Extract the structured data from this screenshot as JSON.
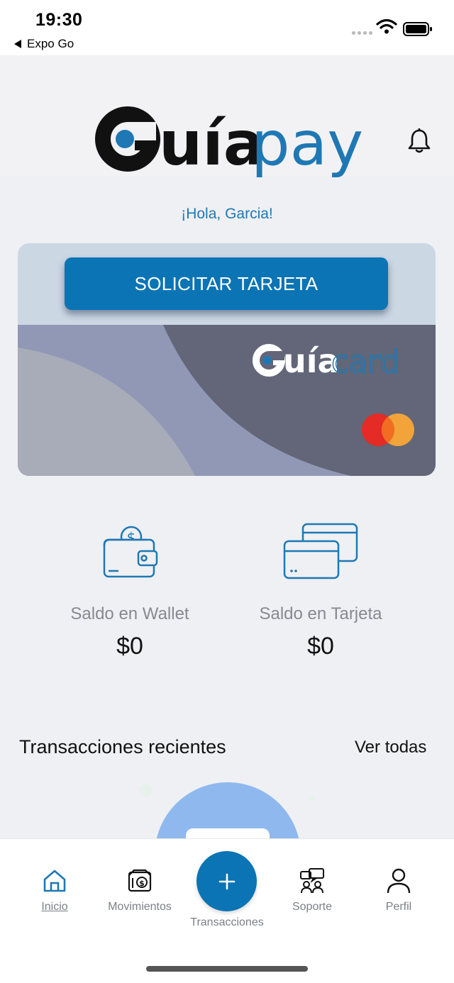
{
  "status_bar": {
    "time": "19:30",
    "back_app": "Expo Go"
  },
  "brand": {
    "name_part1": "Guía",
    "name_part2": "pay",
    "card_part1": "Guía",
    "card_part2": "card"
  },
  "greeting": "¡Hola, Garcia!",
  "card": {
    "request_button": "SOLICITAR TARJETA",
    "network_icon": "mastercard-logo"
  },
  "balances": [
    {
      "label": "Saldo en Wallet",
      "amount": "$0",
      "icon": "wallet-icon"
    },
    {
      "label": "Saldo en Tarjeta",
      "amount": "$0",
      "icon": "cards-icon"
    }
  ],
  "recent": {
    "title": "Transacciones recientes",
    "see_all": "Ver todas"
  },
  "tabs": {
    "inicio": "Inicio",
    "movimientos": "Movimientos",
    "transacciones": "Transacciones",
    "soporte": "Soporte",
    "perfil": "Perfil"
  },
  "colors": {
    "brand_blue": "#0a74b5",
    "greeting": "#1f78b4",
    "card_dark": "#626678",
    "card_mid": "#9198b6"
  }
}
